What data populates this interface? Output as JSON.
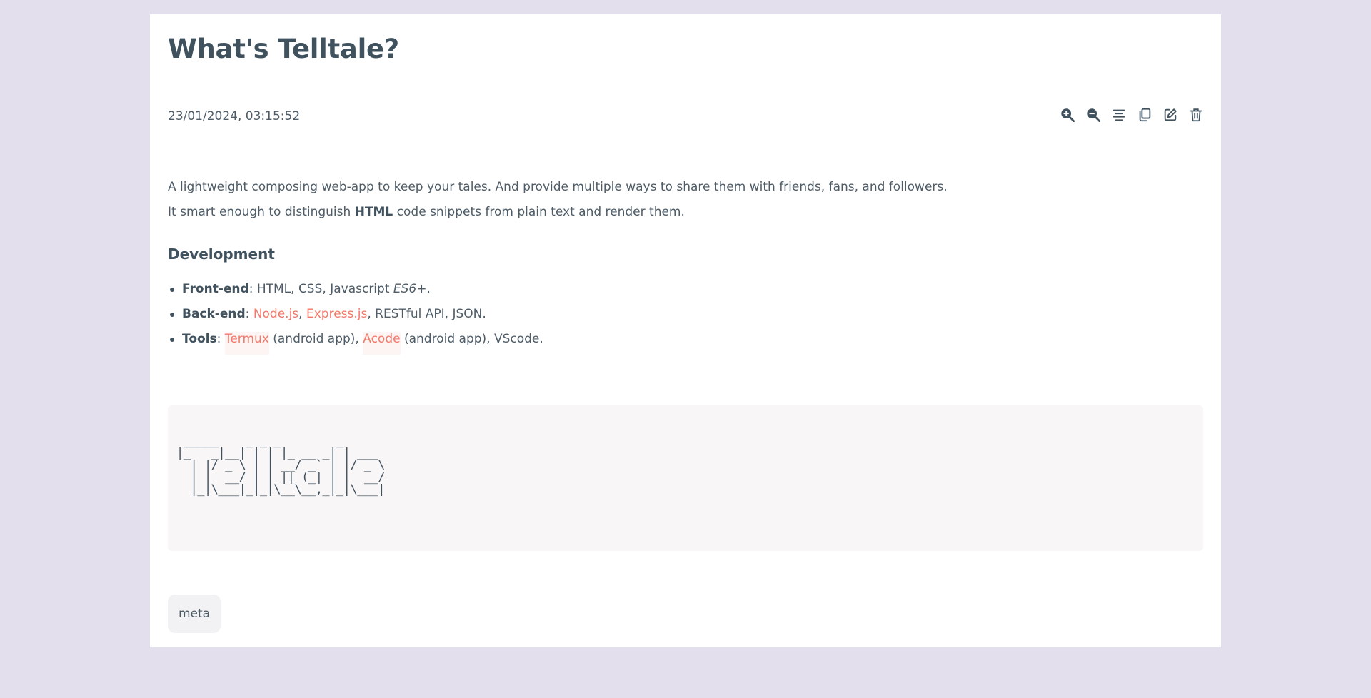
{
  "post": {
    "title": "What's Telltale?",
    "timestamp": "23/01/2024, 03:15:52"
  },
  "toolbar": [
    {
      "name": "zoom-in-icon",
      "label": "zoom in"
    },
    {
      "name": "zoom-out-icon",
      "label": "zoom out"
    },
    {
      "name": "align-center-icon",
      "label": "align center"
    },
    {
      "name": "copy-icon",
      "label": "copy"
    },
    {
      "name": "edit-icon",
      "label": "edit"
    },
    {
      "name": "delete-icon",
      "label": "delete"
    }
  ],
  "content": {
    "intro": "A lightweight composing web-app  to keep your tales. And provide multiple ways to share them with friends, fans, and followers.",
    "line2_prefix": "It smart enough to distinguish ",
    "line2_bold": "HTML",
    "line2_suffix": " code snippets from plain text and render them.",
    "section_heading": "Development",
    "frontend": {
      "label": "Front-end",
      "sep": ": ",
      "text": "HTML, CSS, Javascript ",
      "italic": "ES6+",
      "end": "."
    },
    "backend": {
      "label": "Back-end",
      "sep": ": ",
      "link1": "Node.js",
      "comma": ", ",
      "link2": "Express.js",
      "text": ", RESTful API, JSON."
    },
    "tools": {
      "label": "Tools",
      "sep": ": ",
      "link1": "Termux",
      "mid": " (android app), ",
      "link2": "Acode",
      "text": " (android app), VScode."
    },
    "ascii_art": " _____    _ _ _        _      \n|_   _|__| | | |_ __ _| | ___ \n  | |/ _ \\ | | __/ _` | |/ _ \\\n  | |  __/ | | || (_| | |  __/\n  |_|\\___|_|_|\\__\\__,_|_|\\___|"
  },
  "tags": [
    "meta"
  ],
  "colors": {
    "page_background": "#e3dfed",
    "card_background": "#ffffff",
    "text": "#44535f",
    "link": "#f2786a",
    "code_background": "#f8f6f6",
    "tag_background": "#f2f2f4"
  }
}
